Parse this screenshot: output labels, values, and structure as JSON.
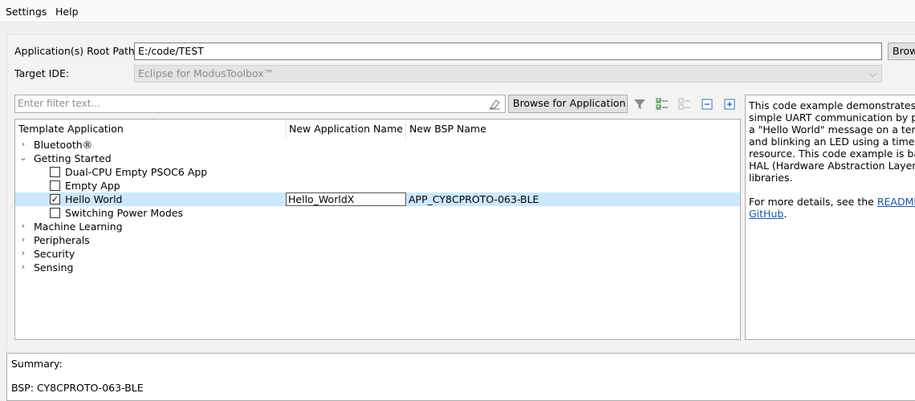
{
  "menu": {
    "settings": "Settings",
    "help": "Help"
  },
  "form": {
    "root_path_label": "Application(s) Root Path:",
    "root_path_value": "E:/code/TEST",
    "browse_label": "Browse...",
    "target_ide_label": "Target IDE:",
    "target_ide_value": "Eclipse for ModusToolbox™"
  },
  "filter": {
    "placeholder": "Enter filter text...",
    "browse_app_label": "Browse for Application..."
  },
  "tree": {
    "columns": {
      "template": "Template Application",
      "app_name": "New Application Name",
      "bsp_name": "New BSP Name"
    },
    "items": {
      "bluetooth": "Bluetooth®",
      "getting_started": "Getting Started",
      "dual_cpu": "Dual-CPU Empty PSOC6 App",
      "empty_app": "Empty App",
      "hello_world": "Hello World",
      "hello_world_app_name": "Hello_WorldX",
      "hello_world_bsp": "APP_CY8CPROTO-063-BLE",
      "switching": "Switching Power Modes",
      "machine_learning": "Machine Learning",
      "peripherals": "Peripherals",
      "security": "Security",
      "sensing": "Sensing"
    }
  },
  "description": {
    "line1": "This code example demonstrates a",
    "line2": "simple UART communication by printing",
    "line3": "a \"Hello World\" message on a terminal",
    "line4": "and blinking an LED using a timer",
    "line5": "resource. This code example is based on",
    "line6": "HAL (Hardware Abstraction Layer)",
    "line7": "libraries.",
    "more_prefix": "For more details, see the ",
    "readme_link": "README on",
    "github_link": "GitHub",
    "suffix": "."
  },
  "summary": {
    "title": "Summary:",
    "bsp": "BSP: CY8CPROTO-063-BLE"
  },
  "colors": {
    "selection": "#cce8ff",
    "link": "#1a56a8"
  }
}
